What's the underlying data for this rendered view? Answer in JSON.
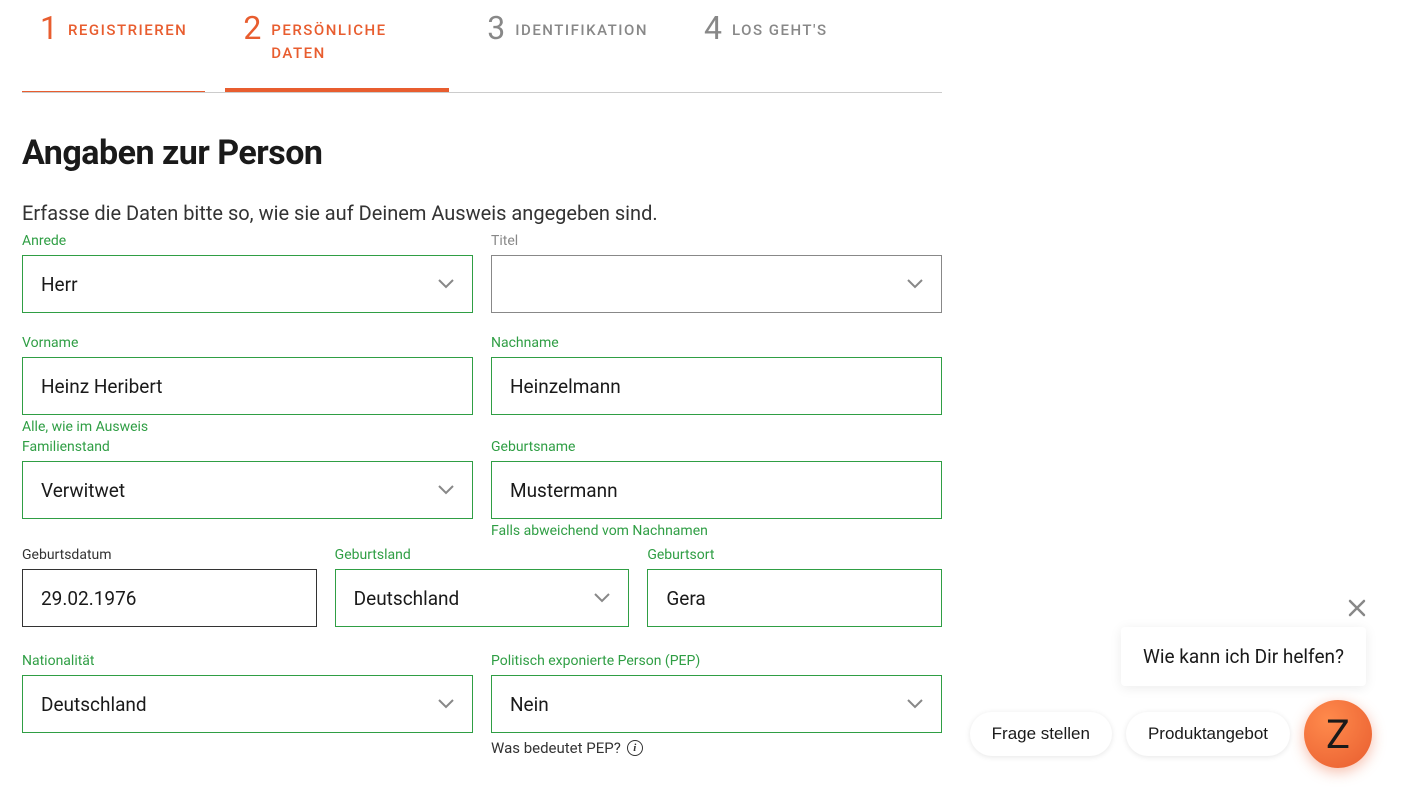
{
  "stepper": {
    "steps": [
      {
        "num": "1",
        "label": "REGISTRIEREN"
      },
      {
        "num": "2",
        "label": "PERSÖNLICHE DATEN"
      },
      {
        "num": "3",
        "label": "IDENTIFIKATION"
      },
      {
        "num": "4",
        "label": "LOS GEHT'S"
      }
    ]
  },
  "title": "Angaben zur Person",
  "subtitle": "Erfasse die Daten bitte so, wie sie auf Deinem Ausweis angegeben sind.",
  "fields": {
    "anrede": {
      "label": "Anrede",
      "value": "Herr"
    },
    "titel": {
      "label": "Titel",
      "value": ""
    },
    "vorname": {
      "label": "Vorname",
      "value": "Heinz Heribert",
      "hint": "Alle, wie im Ausweis"
    },
    "nachname": {
      "label": "Nachname",
      "value": "Heinzelmann"
    },
    "familienstand": {
      "label": "Familienstand",
      "value": "Verwitwet"
    },
    "geburtsname": {
      "label": "Geburtsname",
      "value": "Mustermann",
      "hint": "Falls abweichend vom Nachnamen"
    },
    "geburtsdatum": {
      "label": "Geburtsdatum",
      "value": "29.02.1976"
    },
    "geburtsland": {
      "label": "Geburtsland",
      "value": "Deutschland"
    },
    "geburtsort": {
      "label": "Geburtsort",
      "value": "Gera"
    },
    "nationalitaet": {
      "label": "Nationalität",
      "value": "Deutschland"
    },
    "pep": {
      "label": "Politisch exponierte Person (PEP)",
      "value": "Nein",
      "hint": "Was bedeutet PEP?"
    }
  },
  "chat": {
    "bubble": "Wie kann ich Dir helfen?",
    "actions": {
      "ask": "Frage stellen",
      "offer": "Produktangebot"
    },
    "fab": "Z"
  }
}
